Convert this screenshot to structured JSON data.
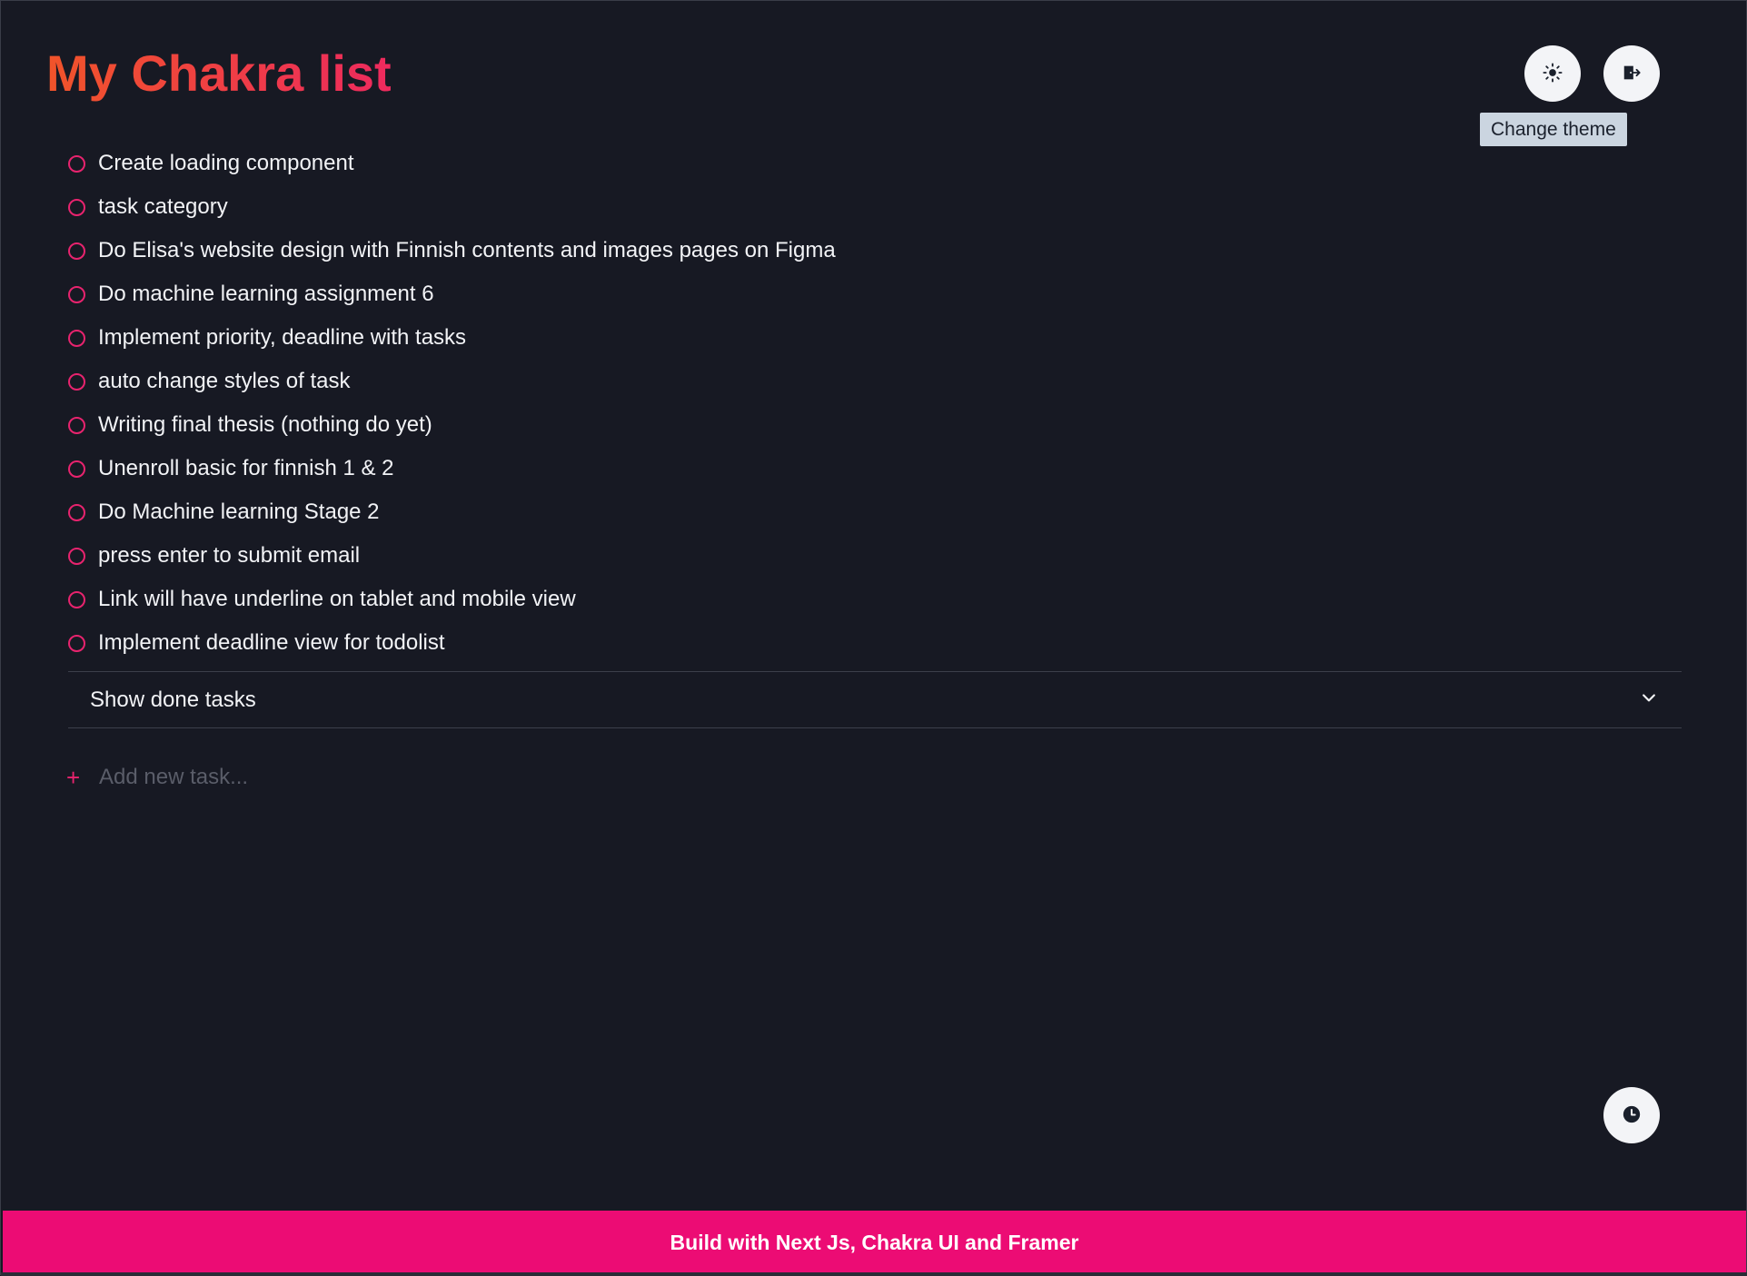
{
  "app": {
    "title": "My Chakra list"
  },
  "header": {
    "theme_button_icon": "sun-icon",
    "logout_button_icon": "logout-icon",
    "tooltip": "Change theme"
  },
  "tasks": [
    {
      "label": "Create loading component",
      "done": false
    },
    {
      "label": "task category",
      "done": false
    },
    {
      "label": "Do Elisa's website design with Finnish contents and images pages on Figma",
      "done": false
    },
    {
      "label": "Do machine learning assignment 6",
      "done": false
    },
    {
      "label": "Implement priority, deadline with tasks",
      "done": false
    },
    {
      "label": "auto change styles of task",
      "done": false
    },
    {
      "label": "Writing final thesis (nothing do yet)",
      "done": false
    },
    {
      "label": "Unenroll basic for finnish 1 & 2",
      "done": false
    },
    {
      "label": "Do Machine learning Stage 2",
      "done": false
    },
    {
      "label": "press enter to submit email",
      "done": false
    },
    {
      "label": "Link will have underline on tablet and mobile view",
      "done": false
    },
    {
      "label": "Implement deadline view for todolist",
      "done": false
    }
  ],
  "done_panel": {
    "label": "Show done tasks",
    "icon": "chevron-down-icon"
  },
  "add_task": {
    "icon": "plus-icon",
    "placeholder": "Add new task...",
    "value": ""
  },
  "fab": {
    "icon": "clock-icon"
  },
  "footer": {
    "text": "Build with Next Js, Chakra UI and Framer"
  },
  "colors": {
    "background": "#171923",
    "accent": "#e8236e",
    "footer": "#ec0c74",
    "title_gradient_start": "#f0542a",
    "title_gradient_end": "#ee2a5e"
  }
}
